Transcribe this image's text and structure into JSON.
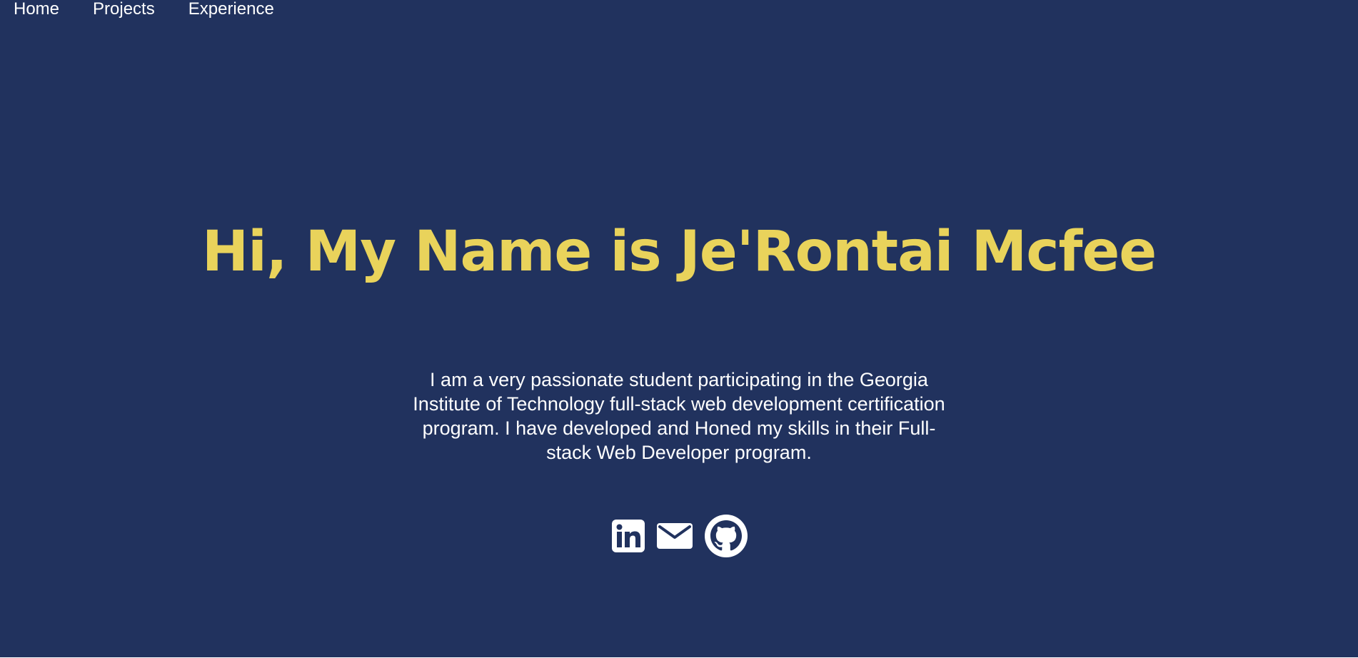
{
  "nav": {
    "items": [
      {
        "label": "Home"
      },
      {
        "label": "Projects"
      },
      {
        "label": "Experience"
      }
    ]
  },
  "hero": {
    "title": "Hi, My Name is Je'Rontai Mcfee",
    "bio": "I am a very passionate student participating in the Georgia Institute of Technology full-stack web development certification program. I have developed and Honed my skills in their Full-stack Web Developer program."
  },
  "socials": [
    {
      "icon": "linkedin-icon"
    },
    {
      "icon": "email-icon"
    },
    {
      "icon": "github-icon"
    }
  ],
  "colors": {
    "background": "#21325e",
    "accent": "#e9d35b",
    "text": "#ffffff"
  }
}
